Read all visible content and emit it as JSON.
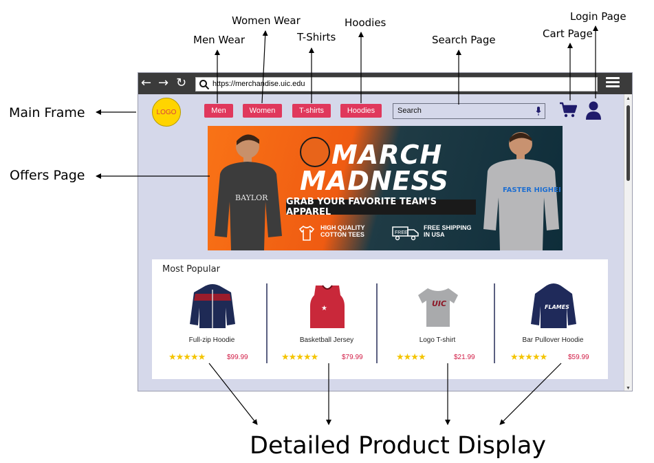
{
  "annotations": {
    "men_wear": "Men Wear",
    "women_wear": "Women Wear",
    "tshirts": "T-Shirts",
    "hoodies": "Hoodies",
    "search_page": "Search Page",
    "cart_page": "Cart Page",
    "login_page": "Login Page",
    "main_frame": "Main Frame",
    "offers_page": "Offers Page",
    "detailed_product_display": "Detailed Product Display"
  },
  "browser": {
    "url": "https://merchandise.uic.edu",
    "back_glyph": "←",
    "forward_glyph": "→",
    "reload_glyph": "↻"
  },
  "site": {
    "logo_text": "LOGO",
    "nav": [
      "Men",
      "Women",
      "T-shirts",
      "Hoodies"
    ],
    "search_placeholder": "Search"
  },
  "banner": {
    "title_line1": "MARCH",
    "title_line2": "MADNESS",
    "subtitle": "GRAB YOUR FAVORITE TEAM'S APPAREL",
    "feature1": "HIGH QUALITY COTTON TEES",
    "feature2": "FREE SHIPPING IN USA",
    "left_shirt_text": "BAYLOR",
    "right_shirt_text": "FASTER HIGHER STRONGER BULLDOGS"
  },
  "popular": {
    "title": "Most Popular",
    "products": [
      {
        "name": "Full-zip Hoodie",
        "stars": "★★★★★",
        "price": "$99.99"
      },
      {
        "name": "Basketball Jersey",
        "stars": "★★★★★",
        "price": "$79.99"
      },
      {
        "name": "Logo T-shirt",
        "stars": "★★★★",
        "price": "$21.99"
      },
      {
        "name": "Bar Pullover Hoodie",
        "stars": "★★★★★",
        "price": "$59.99"
      }
    ]
  },
  "colors": {
    "nav_button": "#e0385c",
    "logo": "#ffd400",
    "page_bg": "#d5d8ea",
    "icon": "#1f1b6b",
    "price": "#d11a44",
    "stars": "#f4c400"
  },
  "icons": [
    "back-icon",
    "forward-icon",
    "reload-icon",
    "search-icon",
    "menu-icon",
    "mic-icon",
    "cart-icon",
    "user-icon"
  ]
}
